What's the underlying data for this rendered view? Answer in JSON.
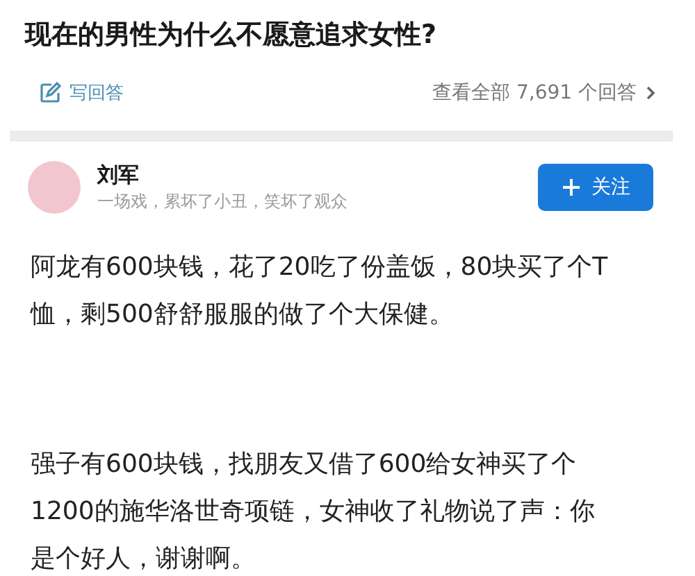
{
  "question": {
    "title": "现在的男性为什么不愿意追求女性?"
  },
  "actions": {
    "write_answer": "写回答",
    "view_all": "查看全部 7,691 个回答"
  },
  "author": {
    "name": "刘军",
    "tagline": "一场戏，累坏了小丑，笑坏了观众",
    "follow_button": "关注"
  },
  "answer": {
    "paragraphs": [
      "阿龙有600块钱，花了20吃了份盖饭，80块买了个T恤，剩500舒舒服服的做了个大保健。",
      "强子有600块钱，找朋友又借了600给女神买了个1200的施华洛世奇项链，女神收了礼物说了声：你是个好人，谢谢啊。"
    ]
  }
}
